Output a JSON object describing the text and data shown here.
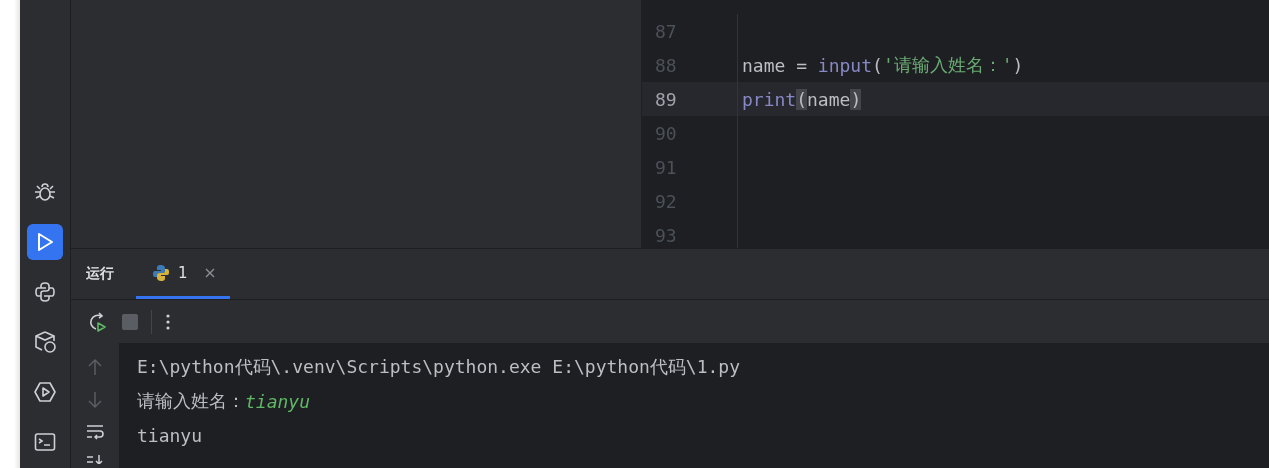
{
  "sidebar": {
    "items": [
      {
        "selected": false
      },
      {
        "selected": true
      },
      {
        "selected": false
      },
      {
        "selected": false
      },
      {
        "selected": false
      },
      {
        "selected": false
      }
    ]
  },
  "editor": {
    "lines": [
      {
        "number": "87",
        "current": false
      },
      {
        "number": "88",
        "current": false,
        "tokens": [
          {
            "kind": "plain",
            "text": "name = "
          },
          {
            "kind": "builtin",
            "text": "input"
          },
          {
            "kind": "plain",
            "text": "("
          },
          {
            "kind": "string",
            "text": "'请输入姓名：'"
          },
          {
            "kind": "plain",
            "text": ")"
          }
        ]
      },
      {
        "number": "89",
        "current": true,
        "tokens": [
          {
            "kind": "builtin",
            "text": "print"
          },
          {
            "kind": "brace",
            "text": "("
          },
          {
            "kind": "plain",
            "text": "name"
          },
          {
            "kind": "brace",
            "text": ")"
          }
        ]
      },
      {
        "number": "90",
        "current": false
      },
      {
        "number": "91",
        "current": false
      },
      {
        "number": "92",
        "current": false
      },
      {
        "number": "93",
        "current": false
      }
    ]
  },
  "run_panel": {
    "title": "运行",
    "tabs": [
      {
        "label": "1",
        "selected": true
      }
    ],
    "console": [
      [
        {
          "kind": "output",
          "text": "E:\\python代码\\.venv\\Scripts\\python.exe E:\\python代码\\1.py"
        }
      ],
      [
        {
          "kind": "output",
          "text": "请输入姓名："
        },
        {
          "kind": "input",
          "text": "tianyu"
        }
      ],
      [
        {
          "kind": "output",
          "text": "tianyu"
        }
      ]
    ]
  }
}
